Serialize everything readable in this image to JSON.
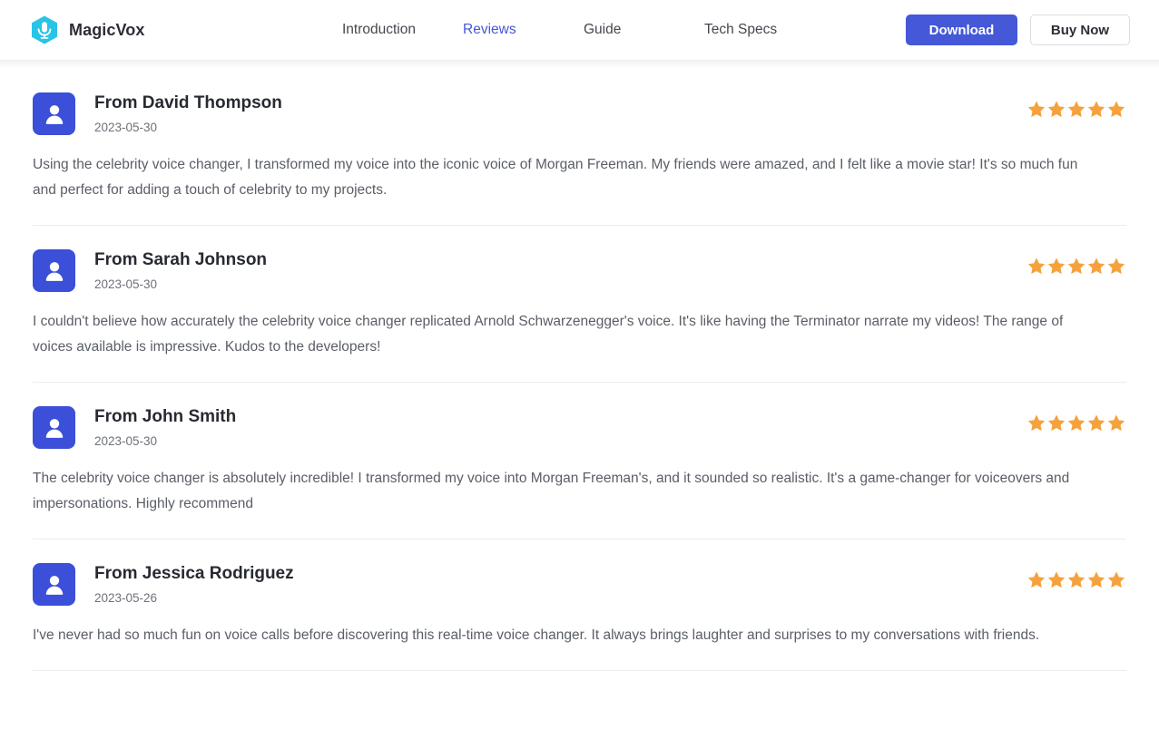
{
  "header": {
    "brand": {
      "name": "MagicVox",
      "logo_icon": "microphone-hexagon-icon",
      "logo_color": "#29c3e8"
    },
    "nav": [
      {
        "label": "Introduction",
        "active": false
      },
      {
        "label": "Reviews",
        "active": true
      },
      {
        "label": "Guide",
        "active": false
      },
      {
        "label": "Tech Specs",
        "active": false
      }
    ],
    "actions": {
      "download_label": "Download",
      "buy_label": "Buy Now",
      "primary_color": "#4458d8"
    }
  },
  "reviews": {
    "star_color": "#f5a23c",
    "items": [
      {
        "avatar_icon": "user-avatar-icon",
        "name": "From David Thompson",
        "date": "2023-05-30",
        "rating": 5,
        "text": "Using the celebrity voice changer, I transformed my voice into the iconic voice of Morgan Freeman. My friends were amazed, and I felt like a movie star! It's so much fun and perfect for adding a touch of celebrity to my projects."
      },
      {
        "avatar_icon": "user-avatar-icon",
        "name": "From Sarah Johnson",
        "date": "2023-05-30",
        "rating": 5,
        "text": "I couldn't believe how accurately the celebrity voice changer replicated Arnold Schwarzenegger's voice. It's like having the Terminator narrate my videos! The range of voices available is impressive. Kudos to the developers!"
      },
      {
        "avatar_icon": "user-avatar-icon",
        "name": "From John Smith",
        "date": "2023-05-30",
        "rating": 5,
        "text": "The celebrity voice changer is absolutely incredible! I transformed my voice into Morgan Freeman's, and it sounded so realistic. It's a game-changer for voiceovers and impersonations. Highly recommend"
      },
      {
        "avatar_icon": "user-avatar-icon",
        "name": "From Jessica Rodriguez",
        "date": "2023-05-26",
        "rating": 5,
        "text": "I've never had so much fun on voice calls before discovering this real-time voice changer. It always brings laughter and surprises to my conversations with friends."
      }
    ]
  }
}
